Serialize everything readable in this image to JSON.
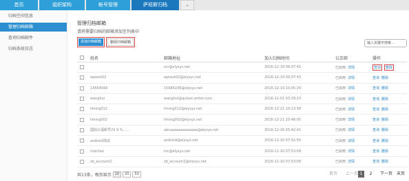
{
  "topnav": {
    "tabs": [
      {
        "label": "首页",
        "active": false
      },
      {
        "label": "组织架构",
        "active": false
      },
      {
        "label": "帐号管理",
        "active": false
      },
      {
        "label": "萨班斯归档",
        "active": true
      }
    ],
    "more_icon": "chevron-down-icon"
  },
  "sidebar": {
    "items": [
      {
        "label": "归档空间信息",
        "active": false
      },
      {
        "label": "管理归档邮箱",
        "active": true
      },
      {
        "label": "查询归档邮件",
        "active": false
      },
      {
        "label": "归档系统日志",
        "active": false
      }
    ]
  },
  "main": {
    "title": "管理归档邮箱",
    "subtitle": "请将需要归档的邮箱添加至列表中",
    "add_button": "添加归档邮箱",
    "delete_button": "删除归档邮箱",
    "search_placeholder": "输入关键字搜索..."
  },
  "table": {
    "headers": {
      "name": "姓名",
      "email": "邮箱地址",
      "date": "加入归档时间",
      "status": "公正邮",
      "ops": "操作"
    },
    "status_label": "已启用",
    "detail_label": "详情",
    "op_query": "查询",
    "op_delete": "删除",
    "rows": [
      {
        "name": "",
        "email": "zcr@elysys.net",
        "date": "2016-12-19 06:07:41"
      },
      {
        "name": "wptest02",
        "email": "wptest02@elysys.net",
        "date": "2016-12-19 00:07:43"
      },
      {
        "name": "14564566",
        "email": "15684236@elysys.net",
        "date": "2016-12-19 10:05:24"
      },
      {
        "name": "wanghui",
        "email": "wanghui@qutest.writer.com",
        "date": "2016-12-01 03:29:23"
      },
      {
        "name": "liming012",
        "email": "liming012@elysys.net",
        "date": "2016-12-21 10:13:58"
      },
      {
        "name": "liming002",
        "email": "liming002@elysys.net",
        "date": "2016-12-21 10:48:05"
      },
      {
        "name": "国际公语账号23 9 %......",
        "email": "abcaaaaaaaaaaaaa@elysys.net",
        "date": "2016-12-16 05:42:41"
      },
      {
        "name": "android测试",
        "email": "android@elysys.net",
        "date": "2016-11-10 07:52:55"
      },
      {
        "name": "machao",
        "email": "mc@elysys.net",
        "date": "2016-11-10 07:53:09"
      },
      {
        "name": "zb_account2",
        "email": "zb_account2@elysys.net",
        "date": "2016-11-10 07:53:09"
      }
    ]
  },
  "footer": {
    "summary": "共13条，每页显示",
    "sizes": [
      "10",
      "20",
      "50"
    ],
    "first": "首页",
    "prev": "上一页",
    "pages": [
      "1",
      "2"
    ],
    "next": "下一页",
    "last": "末页"
  },
  "colors": {
    "primary": "#2e9fd8",
    "active_tab": "#1b78bd",
    "highlight_border": "#d94343"
  }
}
